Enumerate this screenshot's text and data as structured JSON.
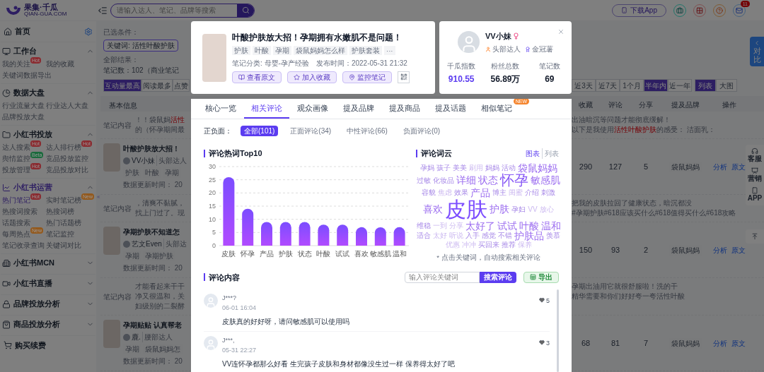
{
  "topbar": {
    "logo": "果集·千瓜",
    "logo_sub": "QIAN-GUA.COM",
    "search_placeholder": "请输入达人、笔记、品牌等搜索",
    "download": "下载App",
    "mail_badge": "11"
  },
  "sidebar": {
    "home": "首页",
    "sections": [
      {
        "title": "工作台",
        "expanded": true,
        "selected": false,
        "items": [
          {
            "label": "我的关注",
            "badge": {
              "text": "Hot",
              "color": "#8a2a2f"
            },
            "selected": false
          },
          {
            "label": "我的收藏",
            "selected": false
          },
          {
            "label": "关键词数据导出",
            "selected": false
          }
        ]
      },
      {
        "title": "数据大盘",
        "expanded": true,
        "selected": false,
        "items": [
          {
            "label": "行业流量大盘",
            "selected": false
          },
          {
            "label": "行业达人大盘",
            "selected": false
          },
          {
            "label": "品牌投放大盘",
            "selected": false
          }
        ]
      },
      {
        "title": "小红书投放",
        "expanded": true,
        "selected": false,
        "items": [
          {
            "label": "达人搜索",
            "badge": {
              "text": "Hot",
              "color": "#8a2a2f"
            },
            "selected": false
          },
          {
            "label": "达人排行榜",
            "badge": {
              "text": "Hot",
              "color": "#8a2a2f"
            },
            "selected": false
          },
          {
            "label": "舆情监控",
            "badge": {
              "text": "Beta",
              "color": "#1a6a3c"
            },
            "selected": false
          },
          {
            "label": "竞品投放监控",
            "selected": false
          },
          {
            "label": "投放管理",
            "badge": {
              "text": "Hot",
              "color": "#8a2a2f"
            },
            "selected": false
          },
          {
            "label": "竞品投放对比",
            "selected": false
          }
        ]
      },
      {
        "title": "小红书运营",
        "expanded": true,
        "selected": true,
        "items": [
          {
            "label": "热门笔记",
            "badge": {
              "text": "Hot",
              "color": "#8a2a2f"
            },
            "selected": true
          },
          {
            "label": "实时笔记榜",
            "badge": {
              "text": "New",
              "color": "#93591d"
            },
            "selected": false
          },
          {
            "label": "热搜词搜索",
            "selected": false
          },
          {
            "label": "热搜词榜",
            "selected": false
          },
          {
            "label": "话题搜索",
            "selected": false
          },
          {
            "label": "热门话题榜",
            "selected": false
          },
          {
            "label": "每周热点",
            "badge": {
              "text": "New",
              "color": "#93591d"
            },
            "selected": false
          },
          {
            "label": "笔记监控",
            "selected": false
          },
          {
            "label": "笔记收录查询",
            "selected": false
          },
          {
            "label": "关键词对比",
            "selected": false
          }
        ]
      },
      {
        "title": "小红书MCN",
        "expanded": false,
        "selected": false
      },
      {
        "title": "小红书直播",
        "expanded": false,
        "selected": false
      },
      {
        "title": "品牌投放分析",
        "expanded": false,
        "selected": false
      },
      {
        "title": "商品投放分析",
        "expanded": false,
        "selected": false
      }
    ],
    "purchase": "购买续费"
  },
  "main": {
    "filters": {
      "label": "已选条件：",
      "chip": "关键词: 活性叶酸护肤",
      "results_label": "全部结果：",
      "results": "笔记数：102（商业笔记"
    },
    "sort": [
      {
        "label": "互动量最高",
        "selected": true
      },
      {
        "label": "阅读最多",
        "selected": false
      },
      {
        "label": "点赞",
        "selected": false
      }
    ],
    "periods": [
      {
        "label": "近3天",
        "selected": false
      },
      {
        "label": "近7天",
        "selected": false
      },
      {
        "label": "1个月",
        "selected": false
      },
      {
        "label": "半年内",
        "selected": true
      },
      {
        "label": "近一年",
        "selected": false
      }
    ],
    "views": [
      {
        "label": "列表",
        "selected": true
      },
      {
        "label": "大图",
        "selected": false
      }
    ],
    "header_left": "基本信息",
    "columns": [
      "收藏",
      "评论",
      "分享",
      "提及品牌",
      "操作"
    ],
    "rows": [
      {
        "kind": "content",
        "label": "笔记内容",
        "left": [
          [
            {
              "text": "！！袋鼠妈",
              "highlight": false
            },
            {
              "text": "活性",
              "highlight": true
            }
          ],
          [
            {
              "text": "的（怀孕期间最",
              "highlight": false
            }
          ]
        ],
        "right": [
          [
            {
              "text": "出油暗沉等问题才能彻底缓解！",
              "highlight": false
            }
          ],
          [
            {
              "text": "以下是我使用",
              "highlight": false
            },
            {
              "text": "活性叶酸护肤",
              "highlight": true
            },
            {
              "text": "的感受： 洁面乳：",
              "highlight": false
            }
          ]
        ]
      },
      {
        "kind": "note",
        "title": "叶酸护肤放大招！",
        "author": "VV小妹",
        "tier": "头部达人",
        "tags": [
          "护肤",
          "叶酸",
          "孕期"
        ],
        "updated": "数据更新时间： 20",
        "values": [
          "290",
          "127",
          "5"
        ],
        "brand": "袋鼠妈妈",
        "actions": [
          "分析",
          "原文"
        ]
      },
      {
        "kind": "content",
        "label": "笔记内容",
        "left": [
          [
            {
              "text": "，清爽不黏腻，",
              "highlight": false
            }
          ],
          [
            {
              "text": "找上门过了。现",
              "highlight": false
            }
          ]
        ],
        "right": [
          [
            {
              "text": "把我的皮肤拉回了健康状态，暗沉都没",
              "highlight": false
            }
          ],
          [
            {
              "text": "#孕期护肤#618应该买什么#618值得买什么#618攻略",
              "highlight": false
            }
          ]
        ]
      },
      {
        "kind": "note",
        "title": "孕期护肤不知道怎",
        "author": "艺文Even",
        "tier": "头部达",
        "tags": [
          "孕期",
          "孕期护肤"
        ],
        "updated": "数据更新时间： 20",
        "values": [
          "150",
          "93",
          "2"
        ],
        "brand": "袋鼠妈妈",
        "actions": [
          "分析",
          "原文"
        ]
      },
      {
        "kind": "content",
        "label": "笔记内容",
        "left": [
          [
            {
              "text": "才能看起来干干",
              "highlight": false
            }
          ],
          [
            {
              "text": "净又很温和，关",
              "highlight": false
            }
          ],
          [
            {
              "text": "妇级别的二裂酵",
              "highlight": false
            }
          ]
        ],
        "right": [
          [
            {
              "text": "孕期出油用它就很舒服啦！洗的干",
              "highlight": false
            }
          ],
          [
            {
              "text": "精华需要和你们好好夸一夸活性叶酸",
              "highlight": false
            }
          ]
        ]
      },
      {
        "kind": "note",
        "title": "孕期贴贴 认真帮老",
        "author": "鹿.",
        "tier": "腰部达人",
        "tags": [
          "孕期",
          "袋鼠妈妈怎"
        ],
        "updated": "数据更新时间： 20",
        "values": [
          "68",
          "81",
          "7"
        ],
        "brand": "袋鼠妈妈",
        "actions": [
          "分析",
          "原文"
        ]
      }
    ]
  },
  "compare": "对比",
  "side_tools": [
    "客服",
    "营销",
    "APP"
  ],
  "modal": {
    "note": {
      "title": "叶酸护肤放大招！孕期拥有水嫩肌不是问题！",
      "tags": [
        "护肤",
        "叶酸",
        "孕期",
        "袋鼠妈妈怎么样",
        "护肤套装",
        "···"
      ],
      "category": "笔记分类: 母婴-孕产经验",
      "published": "发布时间：2022-05-31 21:32",
      "buttons": [
        "查看原文",
        "加入收藏",
        "监控笔记"
      ]
    },
    "profile": {
      "name": "VV小妹",
      "tier": "头部达人",
      "badge": "金冠薯",
      "stats": [
        {
          "label": "千瓜指数",
          "value": "910.55",
          "highlight": true
        },
        {
          "label": "粉丝总数",
          "value": "56.89万",
          "highlight": false
        },
        {
          "label": "笔记数",
          "value": "69",
          "highlight": false
        }
      ]
    },
    "tabs": [
      {
        "label": "核心一览",
        "selected": false
      },
      {
        "label": "相关评论",
        "selected": true
      },
      {
        "label": "观众画像",
        "selected": false
      },
      {
        "label": "提及品牌",
        "selected": false
      },
      {
        "label": "提及商品",
        "selected": false
      },
      {
        "label": "提及话题",
        "selected": false
      },
      {
        "label": "相似笔记",
        "selected": false,
        "badge": "NEW"
      }
    ],
    "sentiment": {
      "label": "正负面：",
      "options": [
        {
          "label": "全部(101)",
          "selected": true
        },
        {
          "label": "正面评论(34)",
          "selected": false
        },
        {
          "label": "中性评论(66)",
          "selected": false
        },
        {
          "label": "负面评论(0)",
          "selected": false
        }
      ]
    },
    "hotwords": {
      "chart_data": {
        "type": "bar",
        "title": "评论热词Top10",
        "categories": [
          "皮肤",
          "怀孕",
          "产品",
          "护肤",
          "状态",
          "叶酸",
          "试试",
          "喜欢",
          "敏感肌",
          "温和"
        ],
        "values": [
          26,
          14,
          9,
          9,
          9,
          8,
          8,
          7,
          7,
          7
        ],
        "ylim": [
          0,
          30
        ],
        "yticks": [
          0,
          5,
          10,
          15,
          20,
          25,
          30
        ],
        "grid": true
      }
    },
    "cloud": {
      "title": "评论词云",
      "views": [
        {
          "label": "图表",
          "selected": true
        },
        {
          "label": "列表",
          "selected": false
        }
      ],
      "note": "* 点击关键词，自动搜索相关评论",
      "words": [
        {
          "text": "孕妈",
          "kind": "s"
        },
        {
          "text": "孩子",
          "kind": "s"
        },
        {
          "text": "美美",
          "kind": "s"
        },
        {
          "text": "刷用",
          "kind": "t"
        },
        {
          "text": "妈妈",
          "kind": "s"
        },
        {
          "text": "活动",
          "kind": "s"
        },
        {
          "text": "袋鼠妈妈",
          "kind": "m"
        },
        {
          "text": "过敏",
          "kind": "s"
        },
        {
          "text": "化妆品",
          "kind": "s"
        },
        {
          "text": "详细",
          "kind": "m"
        },
        {
          "text": "状态",
          "kind": "m"
        },
        {
          "text": "怀孕",
          "kind": "l"
        },
        {
          "text": "敏感肌",
          "kind": "m"
        },
        {
          "text": "容貌",
          "kind": "s"
        },
        {
          "text": "焦虑",
          "kind": "t"
        },
        {
          "text": "效果",
          "kind": "s"
        },
        {
          "text": "产品",
          "kind": "m"
        },
        {
          "text": "博主",
          "kind": "s"
        },
        {
          "text": "闺蜜",
          "kind": "t"
        },
        {
          "text": "介绍",
          "kind": "s"
        },
        {
          "text": "刺激",
          "kind": "s"
        },
        {
          "text": "喜欢",
          "kind": "m"
        },
        {
          "text": "皮肤",
          "kind": "xl"
        },
        {
          "text": "护肤",
          "kind": "m"
        },
        {
          "text": "孕妇",
          "kind": "s"
        },
        {
          "text": "VV",
          "kind": "t"
        },
        {
          "text": "放心",
          "kind": "t"
        },
        {
          "text": "维稳",
          "kind": "s"
        },
        {
          "text": "一到",
          "kind": "t"
        },
        {
          "text": "分享",
          "kind": "t"
        },
        {
          "text": "太好了",
          "kind": "m"
        },
        {
          "text": "试试",
          "kind": "m"
        },
        {
          "text": "叶酸",
          "kind": "m"
        },
        {
          "text": "温和",
          "kind": "m"
        },
        {
          "text": "适合",
          "kind": "s"
        },
        {
          "text": "太好",
          "kind": "t"
        },
        {
          "text": "听说",
          "kind": "t"
        },
        {
          "text": "入手",
          "kind": "s"
        },
        {
          "text": "感觉",
          "kind": "s"
        },
        {
          "text": "不错",
          "kind": "s"
        },
        {
          "text": "护肤品",
          "kind": "m"
        },
        {
          "text": "羡慕",
          "kind": "s"
        },
        {
          "text": "优惠",
          "kind": "t"
        },
        {
          "text": "冲冲",
          "kind": "t"
        },
        {
          "text": "买回来",
          "kind": "s"
        },
        {
          "text": "推荐",
          "kind": "s"
        },
        {
          "text": "保养",
          "kind": "t"
        }
      ]
    },
    "comments": {
      "title": "评论内容",
      "search_placeholder": "输入评论关键词",
      "search_button": "搜索评论",
      "export": "导出",
      "items": [
        {
          "user": "J***?",
          "time": "06-01 16:04",
          "text": "皮肤真的好好呀，请问敏感肌可以使用吗",
          "likes": "5"
        },
        {
          "user": "J***,",
          "time": "05-31 22:27",
          "text": "VV连怀孕都那么好看 生完孩子皮肤和身材都像没生过一样 保养得太好了吧",
          "likes": "3"
        }
      ]
    }
  }
}
